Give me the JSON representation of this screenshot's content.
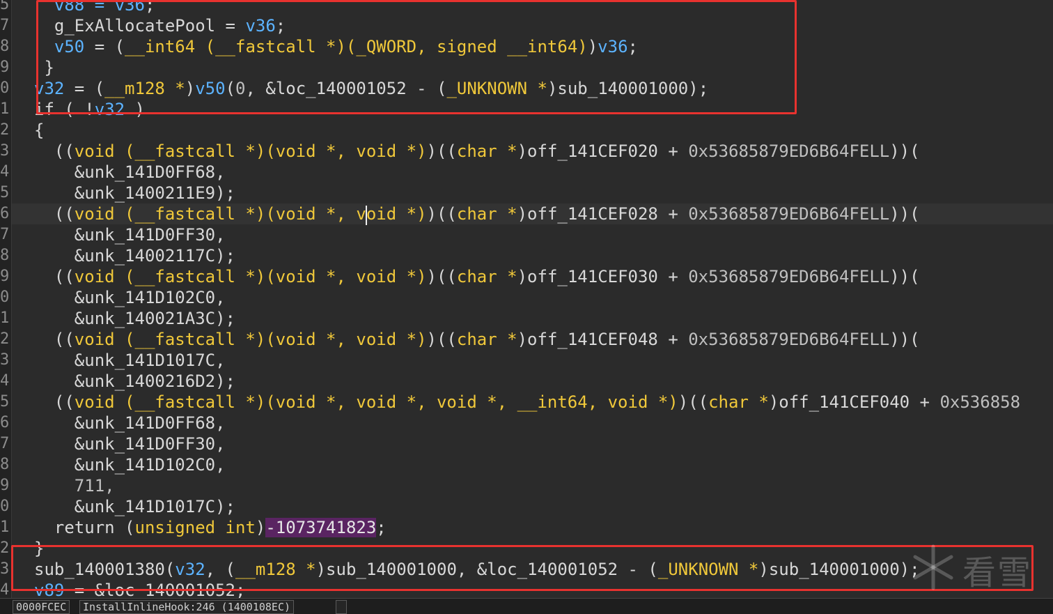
{
  "line_numbers": [
    "5",
    "7",
    "8",
    "9",
    "0",
    "1",
    "2",
    "3",
    "4",
    "5",
    "6",
    "7",
    "8",
    "9",
    "0",
    "1",
    "2",
    "3",
    "4",
    "5",
    "6",
    "7",
    "8",
    "9",
    "0",
    "1",
    "2",
    "3",
    "4"
  ],
  "code_lines": [
    [
      [
        "  v88 = ",
        "t-var"
      ],
      [
        "v36",
        "t-var"
      ],
      [
        ";",
        "t-punct"
      ]
    ],
    [
      [
        "  g_ExAllocatePool = ",
        "t-id"
      ],
      [
        "v36",
        "t-var"
      ],
      [
        ";",
        "t-punct"
      ]
    ],
    [
      [
        "  v50",
        "t-var"
      ],
      [
        " = (",
        "t-op"
      ],
      [
        "__int64 (__fastcall *)(_QWORD, signed __int64)",
        "t-kw"
      ],
      [
        ")",
        "t-op"
      ],
      [
        "v36",
        "t-var"
      ],
      [
        ";",
        "t-punct"
      ]
    ],
    [
      [
        " }",
        "t-punct"
      ]
    ],
    [
      [
        "v32",
        "t-var"
      ],
      [
        " = (",
        "t-op"
      ],
      [
        "__m128 *",
        "t-kw"
      ],
      [
        ")",
        "t-op"
      ],
      [
        "v50",
        "t-var"
      ],
      [
        "(",
        "t-op"
      ],
      [
        "0",
        "t-num"
      ],
      [
        ", &loc_140001052 - (",
        "t-id"
      ],
      [
        "_UNKNOWN *",
        "t-kw"
      ],
      [
        ")sub_140001000);",
        "t-id"
      ]
    ],
    [
      [
        "if ( !",
        "t-id"
      ],
      [
        "v32",
        "t-var"
      ],
      [
        " )",
        "t-id"
      ]
    ],
    [
      [
        "{",
        "t-punct"
      ]
    ],
    [
      [
        "  ((",
        "t-op"
      ],
      [
        "void (__fastcall *)(void *, void *)",
        "t-kw"
      ],
      [
        ")((",
        "t-op"
      ],
      [
        "char *",
        "t-kw"
      ],
      [
        ")off_141CEF020 + ",
        "t-id"
      ],
      [
        "0x53685879ED6B64FELL",
        "t-num"
      ],
      [
        "))(",
        "t-op"
      ]
    ],
    [
      [
        "    &unk_141D0FF68,",
        "t-id"
      ]
    ],
    [
      [
        "    &unk_1400211E9);",
        "t-id"
      ]
    ],
    [
      [
        "  ((",
        "t-op"
      ],
      [
        "void (__fastcall *)(void *, void *)",
        "t-kw"
      ],
      [
        ")((",
        "t-op"
      ],
      [
        "char *",
        "t-kw"
      ],
      [
        ")off_141CEF028 + ",
        "t-id"
      ],
      [
        "0x53685879ED6B64FELL",
        "t-num"
      ],
      [
        "))(",
        "t-op"
      ]
    ],
    [
      [
        "    &unk_141D0FF30,",
        "t-id"
      ]
    ],
    [
      [
        "    &unk_14002117C);",
        "t-id"
      ]
    ],
    [
      [
        "  ((",
        "t-op"
      ],
      [
        "void (__fastcall *)(void *, void *)",
        "t-kw"
      ],
      [
        ")((",
        "t-op"
      ],
      [
        "char *",
        "t-kw"
      ],
      [
        ")off_141CEF030 + ",
        "t-id"
      ],
      [
        "0x53685879ED6B64FELL",
        "t-num"
      ],
      [
        "))(",
        "t-op"
      ]
    ],
    [
      [
        "    &unk_141D102C0,",
        "t-id"
      ]
    ],
    [
      [
        "    &unk_140021A3C);",
        "t-id"
      ]
    ],
    [
      [
        "  ((",
        "t-op"
      ],
      [
        "void (__fastcall *)(void *, void *)",
        "t-kw"
      ],
      [
        ")((",
        "t-op"
      ],
      [
        "char *",
        "t-kw"
      ],
      [
        ")off_141CEF048 + ",
        "t-id"
      ],
      [
        "0x53685879ED6B64FELL",
        "t-num"
      ],
      [
        "))(",
        "t-op"
      ]
    ],
    [
      [
        "    &unk_141D1017C,",
        "t-id"
      ]
    ],
    [
      [
        "    &unk_1400216D2);",
        "t-id"
      ]
    ],
    [
      [
        "  ((",
        "t-op"
      ],
      [
        "void (__fastcall *)(void *, void *, void *, __int64, void *)",
        "t-kw"
      ],
      [
        ")((",
        "t-op"
      ],
      [
        "char *",
        "t-kw"
      ],
      [
        ")off_141CEF040 + ",
        "t-id"
      ],
      [
        "0x536858",
        "t-num"
      ]
    ],
    [
      [
        "    &unk_141D0FF68,",
        "t-id"
      ]
    ],
    [
      [
        "    &unk_141D0FF30,",
        "t-id"
      ]
    ],
    [
      [
        "    &unk_141D102C0,",
        "t-id"
      ]
    ],
    [
      [
        "    711,",
        "t-num"
      ]
    ],
    [
      [
        "    &unk_141D1017C);",
        "t-id"
      ]
    ],
    [
      [
        "  return (",
        "t-id"
      ],
      [
        "unsigned int",
        "t-kw"
      ],
      [
        ")",
        "t-id"
      ],
      [
        "-1073741823",
        "t-neg"
      ],
      [
        ";",
        "t-punct"
      ]
    ],
    [
      [
        "}",
        "t-punct"
      ]
    ],
    [
      [
        "sub_140001380(",
        "t-id"
      ],
      [
        "v32",
        "t-var"
      ],
      [
        ", (",
        "t-id"
      ],
      [
        "__m128 *",
        "t-kw"
      ],
      [
        ")sub_140001000, &loc_140001052 - (",
        "t-id"
      ],
      [
        "_UNKNOWN *",
        "t-kw"
      ],
      [
        ")sub_140001000);",
        "t-id"
      ]
    ],
    [
      [
        "v89",
        "t-var"
      ],
      [
        " = &loc_140001052;",
        "t-id"
      ]
    ]
  ],
  "status": {
    "address": "0000FCEC",
    "location": "InstallInlineHook:246 (1400108EC)"
  },
  "watermark": {
    "text": "看雪"
  }
}
